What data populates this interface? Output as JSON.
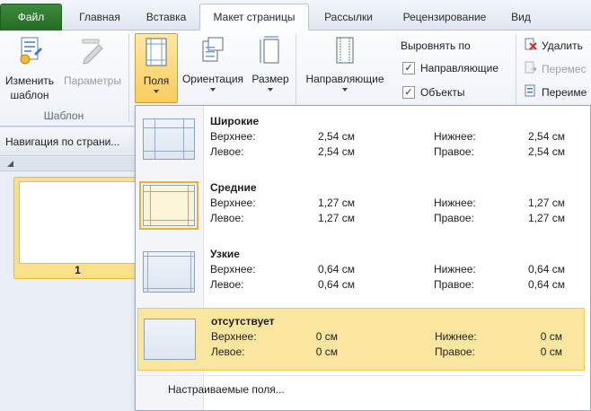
{
  "tabs": [
    {
      "label": "Файл"
    },
    {
      "label": "Главная"
    },
    {
      "label": "Вставка"
    },
    {
      "label": "Макет страницы"
    },
    {
      "label": "Рассылки"
    },
    {
      "label": "Рецензирование"
    },
    {
      "label": "Вид"
    }
  ],
  "ribbon": {
    "template_group": {
      "change_template_line1": "Изменить",
      "change_template_line2": "шаблон",
      "params_label": "Параметры",
      "group_label": "Шаблон"
    },
    "margins_label": "Поля",
    "orientation_label": "Ориентация",
    "size_label": "Размер",
    "guides_label": "Направляющие",
    "align_title": "Выровнять по",
    "align_options": [
      {
        "label": "Направляющие",
        "checked": true
      },
      {
        "label": "Объекты",
        "checked": true
      }
    ],
    "actions": [
      {
        "label": "Удалить",
        "disabled": false
      },
      {
        "label": "Перемес",
        "disabled": true
      },
      {
        "label": "Переиме",
        "disabled": false
      }
    ]
  },
  "nav": {
    "header": "Навигация по страни...",
    "page_number": "1"
  },
  "margins_menu": {
    "presets": [
      {
        "name": "Широкие",
        "top_label": "Верхнее:",
        "top": "2,54 см",
        "left_label": "Левое:",
        "left": "2,54 см",
        "bottom_label": "Нижнее:",
        "bottom": "2,54 см",
        "right_label": "Правое:",
        "right": "2,54 см"
      },
      {
        "name": "Средние",
        "top_label": "Верхнее:",
        "top": "1,27 см",
        "left_label": "Левое:",
        "left": "1,27 см",
        "bottom_label": "Нижнее:",
        "bottom": "1,27 см",
        "right_label": "Правое:",
        "right": "1,27 см"
      },
      {
        "name": "Узкие",
        "top_label": "Верхнее:",
        "top": "0,64 см",
        "left_label": "Левое:",
        "left": "0,64 см",
        "bottom_label": "Нижнее:",
        "bottom": "0,64 см",
        "right_label": "Правое:",
        "right": "0,64 см"
      },
      {
        "name": "отсутствует",
        "top_label": "Верхнее:",
        "top": "0 см",
        "left_label": "Левое:",
        "left": "0 см",
        "bottom_label": "Нижнее:",
        "bottom": "0 см",
        "right_label": "Правое:",
        "right": "0 см"
      }
    ],
    "custom_label": "Настраиваемые поля..."
  },
  "colors": {
    "file_tab": "#2a7a2a",
    "highlight": "#fbe6a0",
    "pressed": "#f9cc5d"
  }
}
